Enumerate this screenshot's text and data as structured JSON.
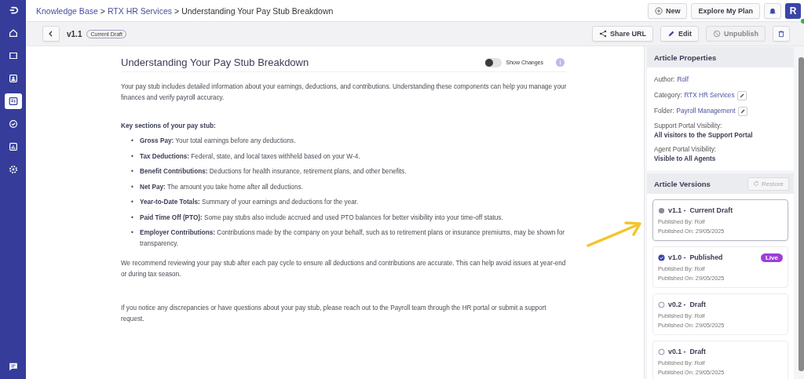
{
  "sidebar": {
    "items": [
      {
        "selected": false
      },
      {
        "selected": false
      },
      {
        "selected": false
      },
      {
        "selected": false
      },
      {
        "selected": true
      },
      {
        "selected": false
      },
      {
        "selected": false
      },
      {
        "selected": false
      }
    ]
  },
  "breadcrumb": [
    {
      "label": "Knowledge Base",
      "link": true
    },
    {
      "label": ">",
      "link": false
    },
    {
      "label": "RTX HR Services",
      "link": true
    },
    {
      "label": ">",
      "link": false
    },
    {
      "label": "Understanding Your Pay Stub Breakdown",
      "link": false
    }
  ],
  "header_actions": {
    "new": "New",
    "explore": "Explore My Plan",
    "avatar": "R",
    "online": true
  },
  "toolbar": {
    "version": "v1.1",
    "badge": "Current Draft",
    "share": "Share URL",
    "edit": "Edit",
    "unpublish": {
      "label": "Unpublish",
      "disabled": true
    }
  },
  "article": {
    "title": "Understanding Your Pay Stub Breakdown",
    "show_changes": {
      "label": "Show Changes",
      "on": false
    },
    "intro": "Your pay stub includes detailed information about your earnings, deductions, and contributions. Understanding these components can help you manage your finances and verify payroll accuracy.",
    "section_heading": "Key sections of your pay stub:",
    "bullet": "•",
    "items": [
      {
        "term": "Gross Pay:",
        "text": "Your total earnings before any deductions."
      },
      {
        "term": "Tax Deductions:",
        "text": "Federal, state, and local taxes withheld based on your W-4."
      },
      {
        "term": "Benefit Contributions:",
        "text": "Deductions for health insurance, retirement plans, and other benefits."
      },
      {
        "term": "Net Pay:",
        "text": "The amount you take home after all deductions."
      },
      {
        "term": "Year-to-Date Totals:",
        "text": "Summary of your earnings and deductions for the year."
      },
      {
        "term": "Paid Time Off (PTO):",
        "text": "Some pay stubs also include accrued and used PTO balances for better visibility into your time-off status."
      },
      {
        "term": "Employer Contributions:",
        "text": "Contributions made by the company on your behalf, such as to retirement plans or insurance premiums, may be shown for transparency."
      }
    ],
    "paragraphs": [
      "We recommend reviewing your pay stub after each pay cycle to ensure all deductions and contributions are accurate. This can help avoid issues at year-end or during tax season.",
      "If you notice any discrepancies or have questions about your pay stub, please reach out to the Payroll team through the HR portal or submit a support request."
    ]
  },
  "properties": {
    "title": "Article Properties",
    "fields": [
      {
        "label": "Author:",
        "value": "Rolf",
        "kind": "link",
        "editable": false
      },
      {
        "label": "Category:",
        "value": "RTX HR Services",
        "kind": "link",
        "editable": true
      },
      {
        "label": "Folder:",
        "value": "Payroll Management",
        "kind": "link",
        "editable": true
      },
      {
        "label": "Support Portal Visibility:",
        "value": "All visitors to the Support Portal",
        "kind": "block"
      },
      {
        "label": "Agent Portal Visibility:",
        "value": "Visible to All Agents",
        "kind": "block"
      }
    ]
  },
  "versions": {
    "title": "Article Versions",
    "restore": {
      "label": "Restore",
      "disabled": true
    },
    "items": [
      {
        "name": "v1.1 -  Current Draft",
        "kind": "current",
        "selected": true,
        "by": "Published By: Rolf",
        "on": "Published On: 29/05/2025"
      },
      {
        "name": "v1.0 -  Published",
        "kind": "published",
        "selected": false,
        "badge": "Live",
        "by": "Published By: Rolf",
        "on": "Published On: 29/05/2025"
      },
      {
        "name": "v0.2 -  Draft",
        "kind": "draft",
        "selected": false,
        "by": "Published By: Rolf",
        "on": "Published On: 29/05/2025"
      },
      {
        "name": "v0.1 -  Draft",
        "kind": "draft",
        "selected": false,
        "by": "Published By: Rolf",
        "on": "Published On: 29/05/2025"
      }
    ]
  }
}
